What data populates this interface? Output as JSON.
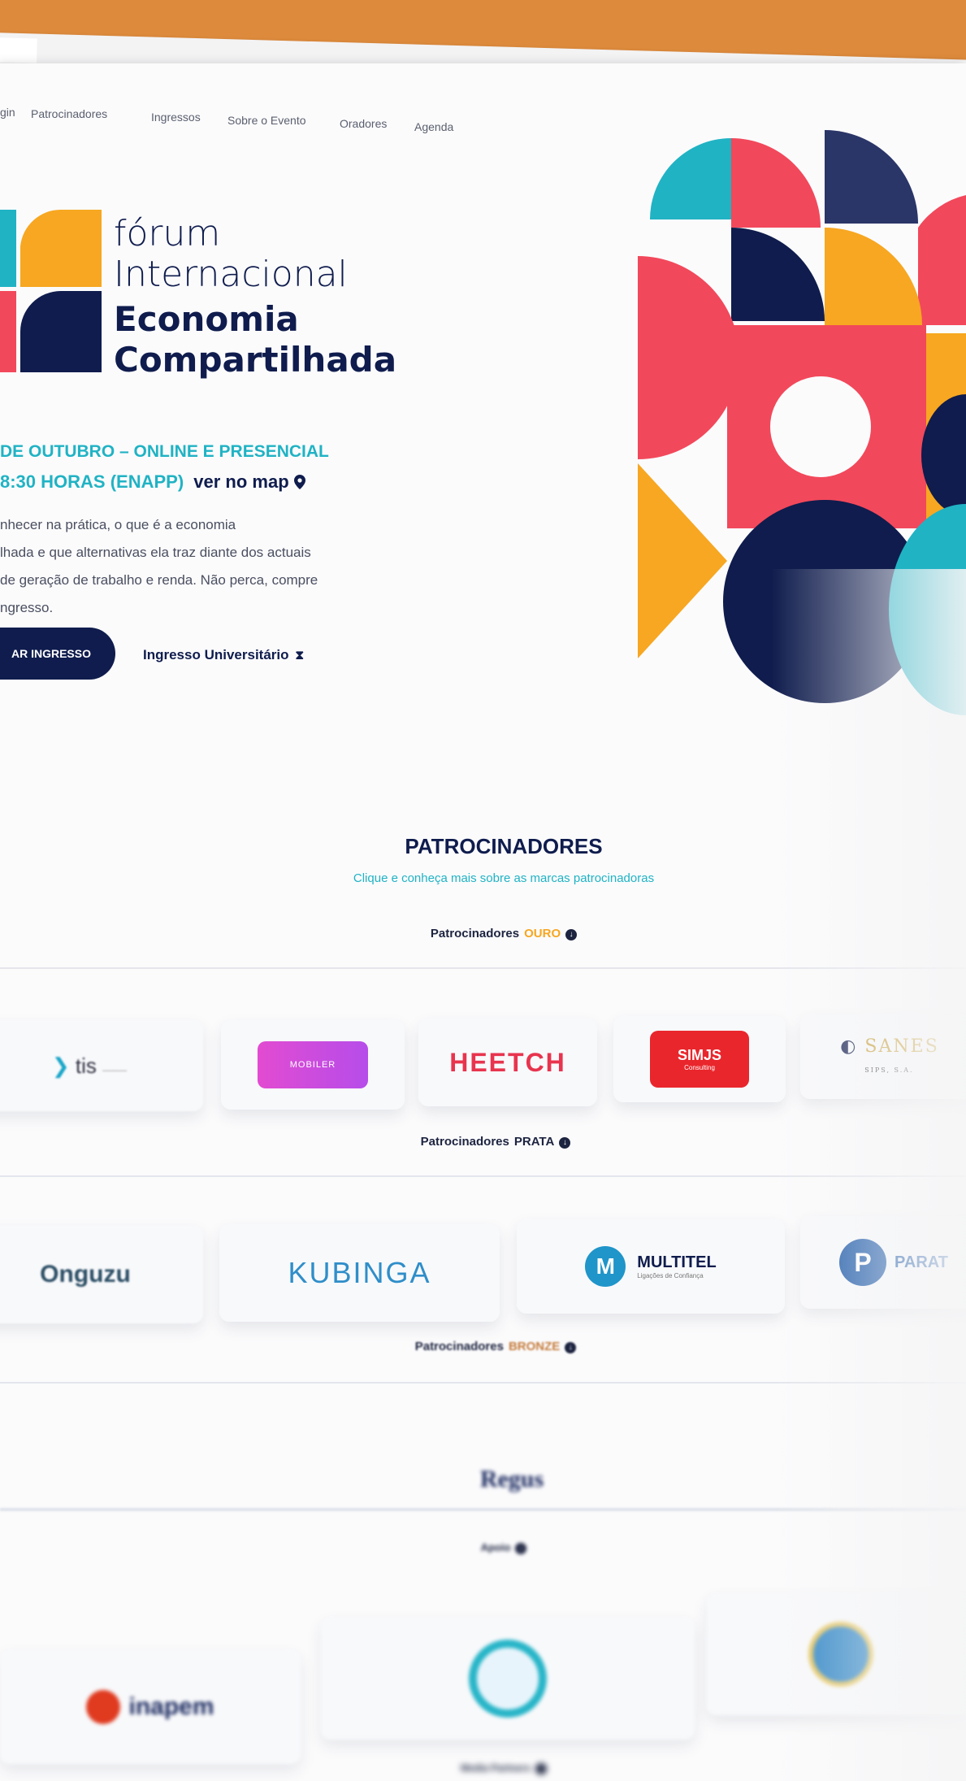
{
  "nav": {
    "login": "gin",
    "items": [
      "Patrocinadores",
      "Ingressos",
      "Sobre o Evento",
      "Oradores",
      "Agenda"
    ]
  },
  "logo": {
    "line1": "fórum",
    "line2": "Internacional",
    "line3": "Economia",
    "line4": "Compartilhada"
  },
  "event": {
    "date_line": "DE OUTUBRO – ONLINE E PRESENCIAL",
    "time_line": "8:30 HORAS (ENAPP)",
    "map_link": "ver no map",
    "map_icon": "map-pin-icon",
    "description": [
      "nhecer na prática, o que é a economia",
      "lhada e que alternativas ela traz diante dos actuais",
      "de geração de trabalho e renda. Não perca, compre",
      "ngresso."
    ],
    "cta": "AR INGRESSO",
    "uni_link": "Ingresso Universitário",
    "uni_icon": "hourglass-icon"
  },
  "sponsors": {
    "title": "PATROCINADORES",
    "subtitle": "Clique e conheça mais sobre as marcas patrocinadoras",
    "tier_gold": {
      "label": "Patrocinadores",
      "level": "OURO"
    },
    "tier_silver": {
      "label": "Patrocinadores",
      "level": "PRATA"
    },
    "tier_bronze": {
      "label": "Patrocinadores",
      "level": "BRONZE"
    },
    "tier_support": {
      "label": "Apoio"
    },
    "tier_media": {
      "label": "Media Partners"
    },
    "gold": [
      "tis",
      "MOBILER",
      "HEETCH",
      "SIMJS",
      "SANES"
    ],
    "gold_sub": {
      "simjs": "Consulting",
      "sanes": "SIPS, S.A."
    },
    "silver": [
      "Onguzu",
      "KUBINGA",
      "MULTITEL",
      "PARAT"
    ],
    "silver_sub": {
      "multitel": "Ligações de Confiança"
    },
    "bronze": [
      "Regus"
    ],
    "support": [
      "inapem"
    ]
  },
  "colors": {
    "navy": "#0f1c4d",
    "teal": "#20b3c4",
    "coral": "#f2485b",
    "gold": "#f7a721",
    "frame": "#dd8a3c",
    "level_gold": "#f7a721",
    "level_bronze": "#c57c3d"
  }
}
